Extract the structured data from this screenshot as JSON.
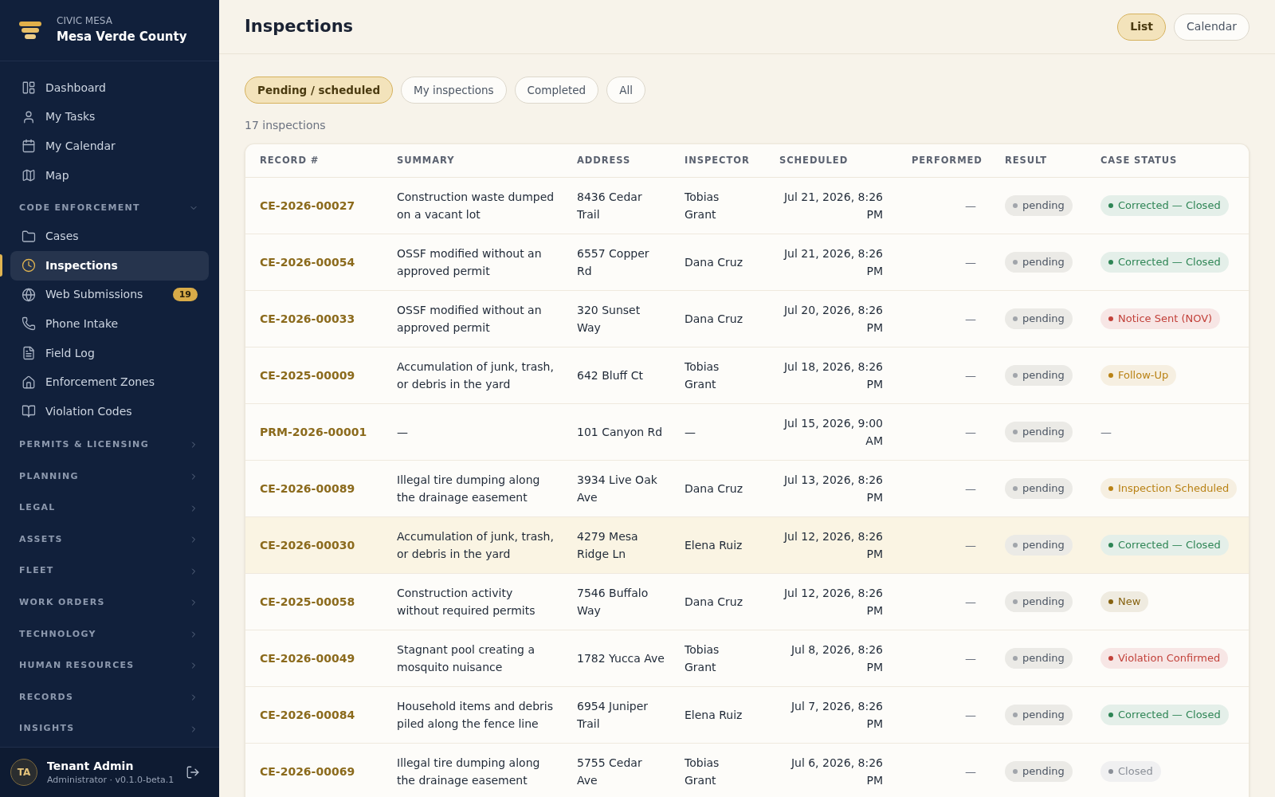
{
  "sidebar": {
    "brand": {
      "org": "CIVIC MESA",
      "name": "Mesa Verde County"
    },
    "items": [
      {
        "label": "Dashboard",
        "selected": false
      },
      {
        "label": "My Tasks",
        "selected": false
      },
      {
        "label": "My Calendar",
        "selected": false
      },
      {
        "label": "Map",
        "selected": false
      }
    ],
    "sections": [
      {
        "label": "CODE ENFORCEMENT",
        "expanded": true,
        "items": [
          {
            "label": "Cases",
            "selected": false
          },
          {
            "label": "Inspections",
            "selected": true
          },
          {
            "label": "Web Submissions",
            "selected": false,
            "badge": "19"
          },
          {
            "label": "Phone Intake",
            "selected": false
          },
          {
            "label": "Field Log",
            "selected": false
          },
          {
            "label": "Enforcement Zones",
            "selected": false
          },
          {
            "label": "Violation Codes",
            "selected": false
          }
        ]
      },
      {
        "label": "PERMITS & LICENSING",
        "expanded": false
      },
      {
        "label": "PLANNING",
        "expanded": false
      },
      {
        "label": "LEGAL",
        "expanded": false
      },
      {
        "label": "ASSETS",
        "expanded": false
      },
      {
        "label": "FLEET",
        "expanded": false
      },
      {
        "label": "WORK ORDERS",
        "expanded": false
      },
      {
        "label": "TECHNOLOGY",
        "expanded": false
      },
      {
        "label": "HUMAN RESOURCES",
        "expanded": false
      },
      {
        "label": "RECORDS",
        "expanded": false
      },
      {
        "label": "INSIGHTS",
        "expanded": false
      }
    ],
    "user": {
      "initials": "TA",
      "name": "Tenant Admin",
      "role": "Administrator · v0.1.0-beta.1"
    }
  },
  "header": {
    "title": "Inspections",
    "view_toggle": [
      {
        "label": "List",
        "selected": true
      },
      {
        "label": "Calendar",
        "selected": false
      }
    ]
  },
  "filters": [
    {
      "label": "Pending / scheduled",
      "selected": true
    },
    {
      "label": "My inspections",
      "selected": false
    },
    {
      "label": "Completed",
      "selected": false
    },
    {
      "label": "All",
      "selected": false
    }
  ],
  "result_count": "17 inspections",
  "table": {
    "columns": [
      "RECORD #",
      "SUMMARY",
      "ADDRESS",
      "INSPECTOR",
      "SCHEDULED",
      "PERFORMED",
      "RESULT",
      "CASE STATUS"
    ],
    "rows": [
      {
        "record": "CE-2026-00027",
        "summary": "Construction waste dumped on a vacant lot",
        "address": "8436 Cedar Trail",
        "inspector": "Tobias Grant",
        "scheduled": "Jul 21, 2026, 8:26 PM",
        "performed": "—",
        "result": "pending",
        "case_status": {
          "label": "Corrected — Closed",
          "color": "#2e8555"
        },
        "selected": false
      },
      {
        "record": "CE-2026-00054",
        "summary": "OSSF modified without an approved permit",
        "address": "6557 Copper Rd",
        "inspector": "Dana Cruz",
        "scheduled": "Jul 21, 2026, 8:26 PM",
        "performed": "—",
        "result": "pending",
        "case_status": {
          "label": "Corrected — Closed",
          "color": "#2e8555"
        },
        "selected": false
      },
      {
        "record": "CE-2026-00033",
        "summary": "OSSF modified without an approved permit",
        "address": "320 Sunset Way",
        "inspector": "Dana Cruz",
        "scheduled": "Jul 20, 2026, 8:26 PM",
        "performed": "—",
        "result": "pending",
        "case_status": {
          "label": "Notice Sent (NOV)",
          "color": "#c2413a"
        },
        "selected": false
      },
      {
        "record": "CE-2025-00009",
        "summary": "Accumulation of junk, trash, or debris in the yard",
        "address": "642 Bluff Ct",
        "inspector": "Tobias Grant",
        "scheduled": "Jul 18, 2026, 8:26 PM",
        "performed": "—",
        "result": "pending",
        "case_status": {
          "label": "Follow-Up",
          "color": "#b98215"
        },
        "selected": false
      },
      {
        "record": "PRM-2026-00001",
        "summary": "—",
        "address": "101 Canyon Rd",
        "inspector": "—",
        "scheduled": "Jul 15, 2026, 9:00 AM",
        "performed": "—",
        "result": "pending",
        "case_status": {
          "label": "—"
        },
        "selected": false
      },
      {
        "record": "CE-2026-00089",
        "summary": "Illegal tire dumping along the drainage easement",
        "address": "3934 Live Oak Ave",
        "inspector": "Dana Cruz",
        "scheduled": "Jul 13, 2026, 8:26 PM",
        "performed": "—",
        "result": "pending",
        "case_status": {
          "label": "Inspection Scheduled",
          "color": "#b98215"
        },
        "selected": false
      },
      {
        "record": "CE-2026-00030",
        "summary": "Accumulation of junk, trash, or debris in the yard",
        "address": "4279 Mesa Ridge Ln",
        "inspector": "Elena Ruiz",
        "scheduled": "Jul 12, 2026, 8:26 PM",
        "performed": "—",
        "result": "pending",
        "case_status": {
          "label": "Corrected — Closed",
          "color": "#2e8555"
        },
        "selected": true
      },
      {
        "record": "CE-2025-00058",
        "summary": "Construction activity without required permits",
        "address": "7546 Buffalo Way",
        "inspector": "Dana Cruz",
        "scheduled": "Jul 12, 2026, 8:26 PM",
        "performed": "—",
        "result": "pending",
        "case_status": {
          "label": "New",
          "color": "#86620f"
        },
        "selected": false
      },
      {
        "record": "CE-2026-00049",
        "summary": "Stagnant pool creating a mosquito nuisance",
        "address": "1782 Yucca Ave",
        "inspector": "Tobias Grant",
        "scheduled": "Jul 8, 2026, 8:26 PM",
        "performed": "—",
        "result": "pending",
        "case_status": {
          "label": "Violation Confirmed",
          "color": "#c2413a"
        },
        "selected": false
      },
      {
        "record": "CE-2026-00084",
        "summary": "Household items and debris piled along the fence line",
        "address": "6954 Juniper Trail",
        "inspector": "Elena Ruiz",
        "scheduled": "Jul 7, 2026, 8:26 PM",
        "performed": "—",
        "result": "pending",
        "case_status": {
          "label": "Corrected — Closed",
          "color": "#2e8555"
        },
        "selected": false
      },
      {
        "record": "CE-2026-00069",
        "summary": "Illegal tire dumping along the drainage easement",
        "address": "5755 Cedar Ave",
        "inspector": "Tobias Grant",
        "scheduled": "Jul 6, 2026, 8:26 PM",
        "performed": "—",
        "result": "pending",
        "case_status": {
          "label": "Closed",
          "color": "#8a8f97"
        },
        "selected": false
      }
    ]
  }
}
